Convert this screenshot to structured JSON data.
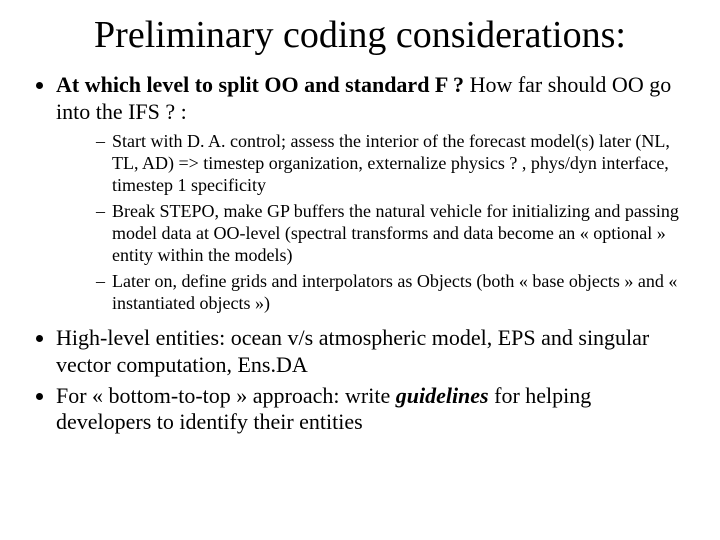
{
  "title": "Preliminary coding considerations:",
  "bullets": {
    "b1_lead": "At which level to split OO and standard F ?",
    "b1_rest": " How far should OO go into the IFS ? :",
    "b1_sub1": "Start with D. A. control; assess the interior of the forecast model(s) later (NL, TL, AD) => timestep organization, externalize physics ? , phys/dyn interface, timestep 1 specificity",
    "b1_sub2": "Break STEPO, make GP buffers the natural vehicle for initializing and passing model data at OO-level (spectral transforms and data become an « optional » entity within the models)",
    "b1_sub3": "Later on, define grids and interpolators as Objects (both « base objects » and « instantiated objects »)",
    "b2": "High-level entities: ocean v/s atmospheric model, EPS and singular vector computation, Ens.DA",
    "b3_a": "For « bottom-to-top » approach: write ",
    "b3_emph": "guidelines",
    "b3_b": " for helping developers to identify their entities"
  }
}
